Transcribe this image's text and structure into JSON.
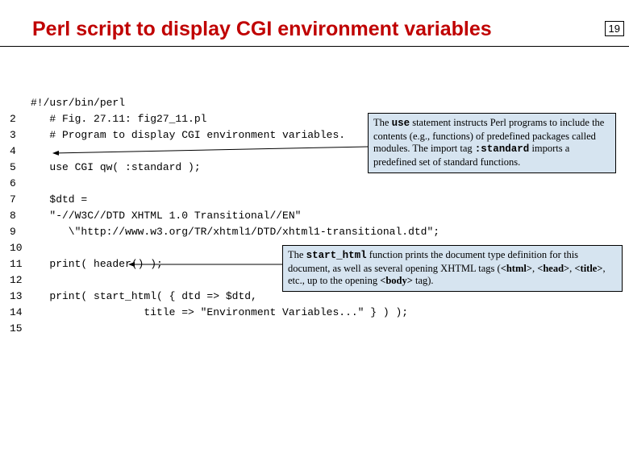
{
  "slide": {
    "number": "19"
  },
  "title": "Perl script to display CGI environment variables",
  "code": {
    "shebang": "#!/usr/bin/perl",
    "lines": [
      {
        "n": "2",
        "text": "   # Fig. 27.11: fig27_11.pl"
      },
      {
        "n": "3",
        "text": "   # Program to display CGI environment variables."
      },
      {
        "n": "4",
        "text": ""
      },
      {
        "n": "5",
        "text": "   use CGI qw( :standard );"
      },
      {
        "n": "6",
        "text": ""
      },
      {
        "n": "7",
        "text": "   $dtd ="
      },
      {
        "n": "8",
        "text": "   \"-//W3C//DTD XHTML 1.0 Transitional//EN\""
      },
      {
        "n": "9",
        "text": "      \\\"http://www.w3.org/TR/xhtml1/DTD/xhtml1-transitional.dtd\";"
      },
      {
        "n": "10",
        "text": ""
      },
      {
        "n": "11",
        "text": "   print( header() );"
      },
      {
        "n": "12",
        "text": ""
      },
      {
        "n": "13",
        "text": "   print( start_html( { dtd => $dtd,"
      },
      {
        "n": "14",
        "text": "                  title => \"Environment Variables...\" } ) );"
      },
      {
        "n": "15",
        "text": ""
      }
    ]
  },
  "callouts": {
    "c1": {
      "p1": "The ",
      "use": "use",
      "p2": " statement instructs Perl programs to include the contents (e.g., functions) of predefined packages called modules. The import tag ",
      "std": ":standard",
      "p3": " imports a predefined set of standard functions."
    },
    "c2": {
      "p1": "The ",
      "fn": "start_html",
      "p2": " function prints the document type definition for this document, as well as several opening XHTML tags (",
      "t1": "<html>",
      "sep1": ", ",
      "t2": "<head>",
      "sep2": ", ",
      "t3": "<title>",
      "p3": ", etc., up to the opening ",
      "t4": "<body>",
      "p4": " tag)."
    }
  }
}
